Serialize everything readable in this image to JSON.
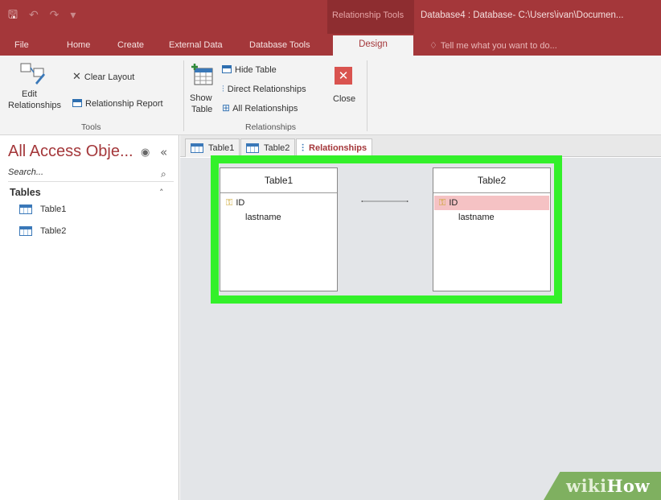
{
  "quick_access": {
    "save_icon": "save-icon",
    "undo_icon": "undo-icon",
    "redo_icon": "redo-icon",
    "customize_icon": "customize-icon"
  },
  "titlebar": {
    "context_label": "Relationship Tools",
    "document_title": "Database4 : Database- C:\\Users\\ivan\\Documen..."
  },
  "ribbon_tabs": [
    {
      "label": "File"
    },
    {
      "label": "Home"
    },
    {
      "label": "Create"
    },
    {
      "label": "External Data"
    },
    {
      "label": "Database Tools"
    },
    {
      "label": "Design"
    }
  ],
  "tell_me": {
    "text": "Tell me what you want to do..."
  },
  "ribbon": {
    "tools": {
      "edit_relationships_line1": "Edit",
      "edit_relationships_line2": "Relationships",
      "clear_layout": "Clear Layout",
      "relationship_report": "Relationship Report",
      "group_label": "Tools"
    },
    "relationships": {
      "show_table_line1": "Show",
      "show_table_line2": "Table",
      "hide_table": "Hide Table",
      "direct_relationships": "Direct Relationships",
      "all_relationships": "All Relationships",
      "close": "Close",
      "group_label": "Relationships"
    }
  },
  "nav": {
    "title": "All Access Obje...",
    "search_placeholder": "Search...",
    "group": "Tables",
    "items": [
      {
        "label": "Table1"
      },
      {
        "label": "Table2"
      }
    ]
  },
  "object_tabs": [
    {
      "label": "Table1"
    },
    {
      "label": "Table2"
    },
    {
      "label": "Relationships"
    }
  ],
  "tables": [
    {
      "name": "Table1",
      "fields": [
        {
          "name": "ID",
          "key": true
        },
        {
          "name": "lastname",
          "key": false
        }
      ]
    },
    {
      "name": "Table2",
      "fields": [
        {
          "name": "ID",
          "key": true
        },
        {
          "name": "lastname",
          "key": false
        }
      ]
    }
  ],
  "colors": {
    "accent": "#a4373a",
    "highlight": "#33f02a",
    "workspace": "#e3e5e8",
    "selected_field": "#f5c2c4"
  },
  "watermark": {
    "part1": "wiki",
    "part2": "How"
  }
}
